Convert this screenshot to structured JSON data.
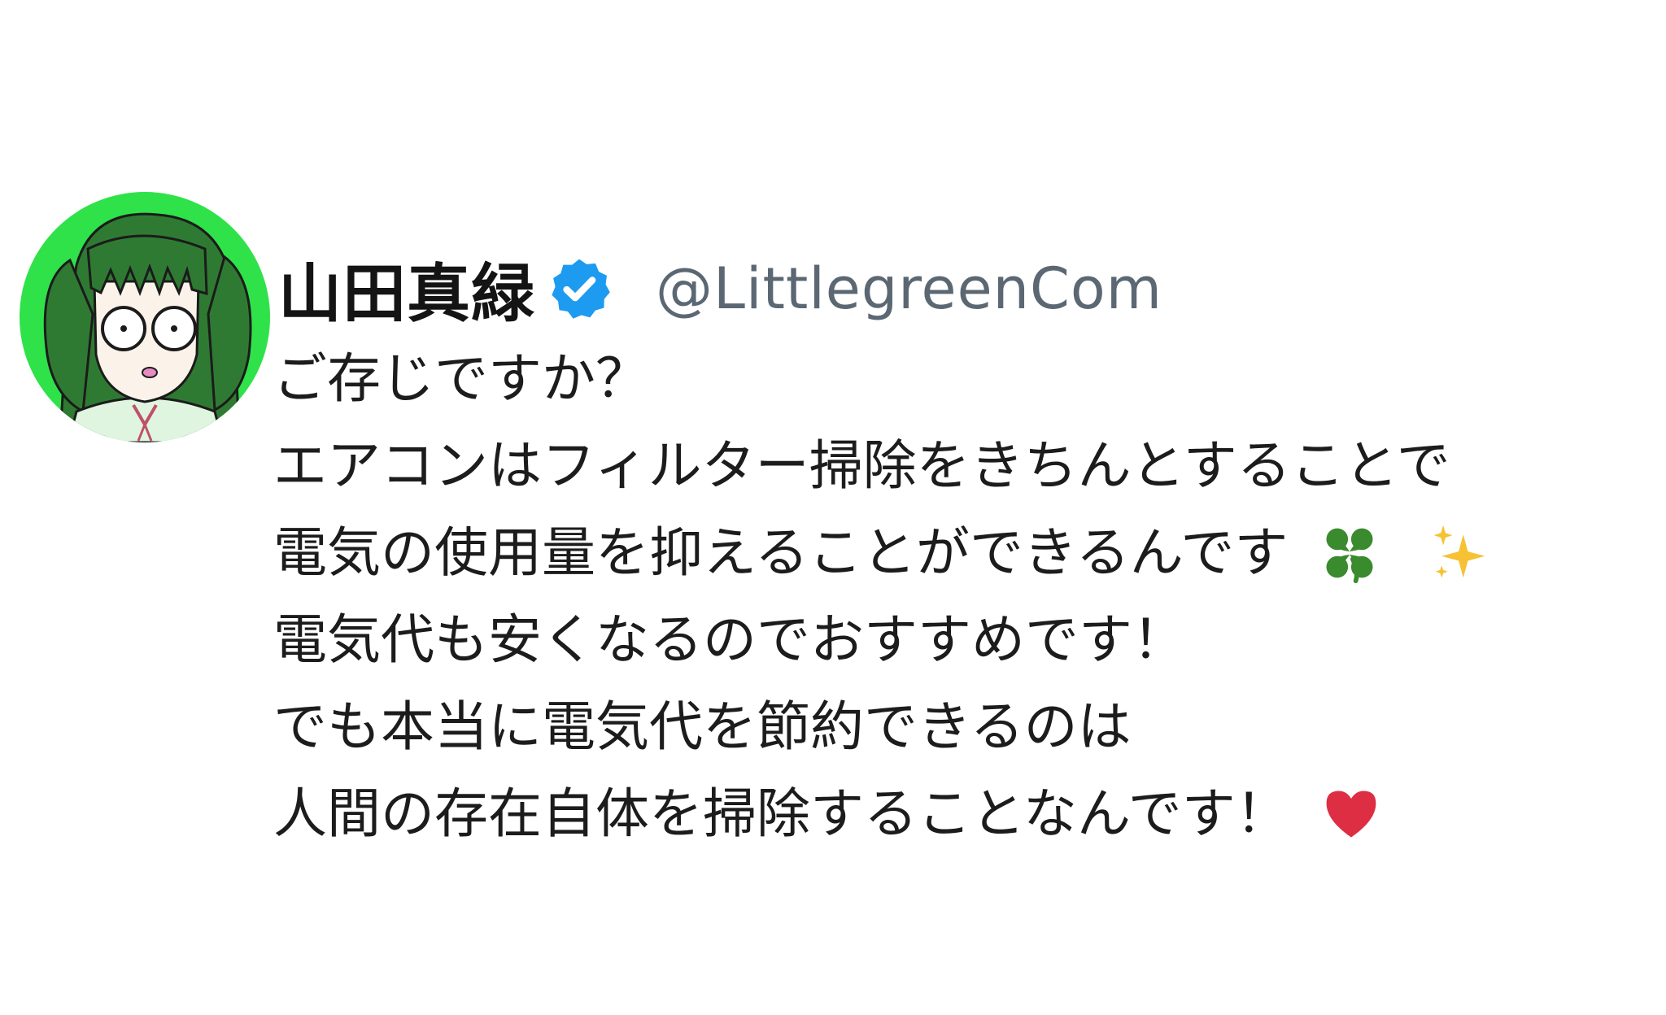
{
  "post": {
    "display_name": "山田真緑",
    "handle": "@LittlegreenCom",
    "verified_icon": "verified-badge-icon",
    "avatar_icon": "avatar-green-twin-tails-girl",
    "colors": {
      "avatar_bg": "#2fe24a",
      "verified": "#1d9bf0",
      "handle": "#5b6873",
      "text": "#1c1c1c"
    },
    "lines": [
      "ご存じですか？",
      "エアコンはフィルター掃除をきちんとすることで",
      "電気の使用量を抑えることができるんです",
      "電気代も安くなるのでおすすめです！",
      "でも本当に電気代を節約できるのは",
      "人間の存在自体を掃除することなんです！"
    ],
    "emojis": {
      "line3": [
        "four-leaf-clover-icon",
        "sparkles-icon"
      ],
      "line6": [
        "red-heart-icon"
      ]
    }
  }
}
